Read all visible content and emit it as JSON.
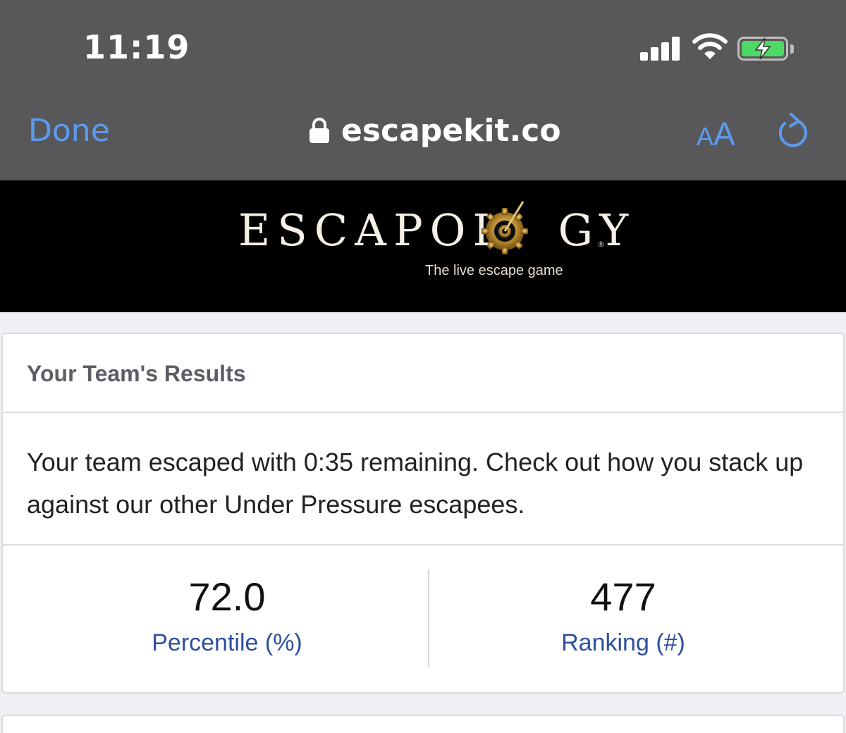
{
  "status_bar": {
    "time": "11:19",
    "signal_icon": "cellular-signal-icon",
    "wifi_icon": "wifi-icon",
    "battery_icon": "battery-charging-icon"
  },
  "browser": {
    "done_label": "Done",
    "url": "escapekit.co",
    "lock_icon": "lock-icon",
    "text_size_small": "A",
    "text_size_big": "A",
    "reload_icon": "reload-icon",
    "accent_color": "#5b9bf0"
  },
  "banner": {
    "brand_prefix": "ESCAPOL",
    "brand_suffix": "GY",
    "registered_mark": "®",
    "tagline": "The live escape game",
    "logo_icon": "gear-icon"
  },
  "results": {
    "title": "Your Team's Results",
    "message": "Your team escaped with 0:35 remaining. Check out how you stack up against our other Under Pressure escapees.",
    "stats": [
      {
        "value": "72.0",
        "label": "Percentile (%)"
      },
      {
        "value": "477",
        "label": "Ranking (#)"
      }
    ],
    "label_color": "#2d4f9c"
  }
}
